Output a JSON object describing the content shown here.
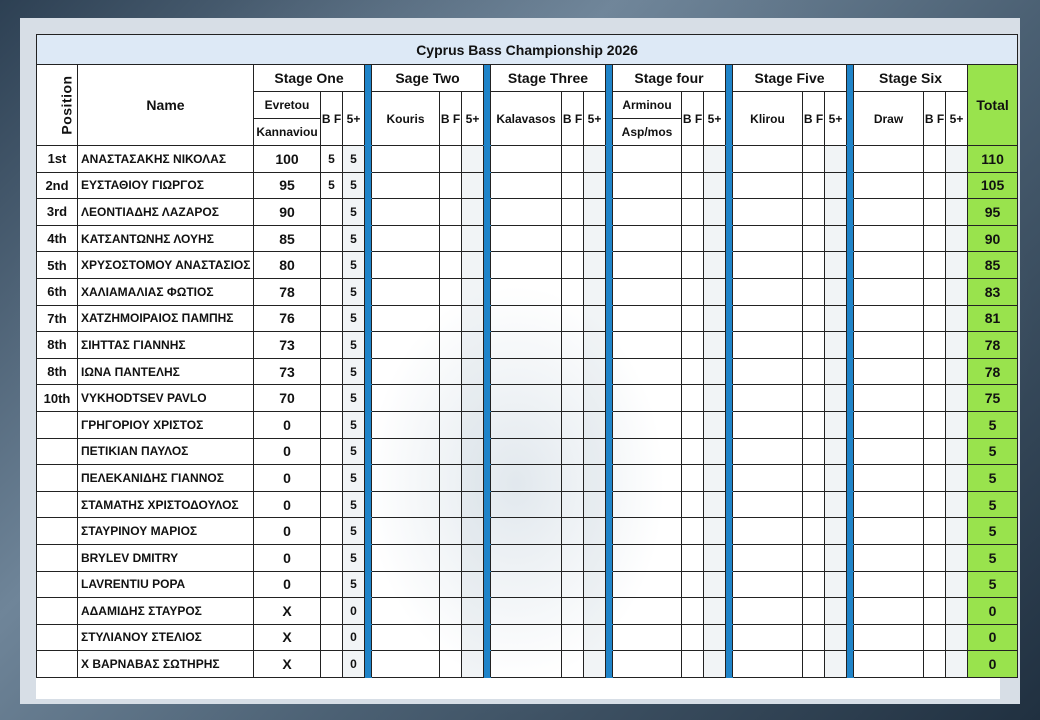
{
  "title": "Cyprus Bass Championship 2026",
  "header": {
    "position": "Position",
    "name": "Name",
    "total": "Total",
    "bf": "B F",
    "five_plus": "5+"
  },
  "stages": [
    {
      "name": "Stage One",
      "venue_top": "Evretou",
      "venue_bottom": "Kannaviou"
    },
    {
      "name": "Sage Two",
      "venue": "Kouris"
    },
    {
      "name": "Stage Three",
      "venue": "Kalavasos"
    },
    {
      "name": "Stage four",
      "venue_top": "Arminou",
      "venue_bottom": "Asp/mos"
    },
    {
      "name": "Stage Five",
      "venue": "Klirou"
    },
    {
      "name": "Stage Six",
      "venue": "Draw"
    }
  ],
  "rows": [
    {
      "pos": "1st",
      "name": "ΑΝΑΣΤΑΣΑΚΗΣ ΝΙΚΟΛΑΣ",
      "s1": "100",
      "bf": "5",
      "five": "5",
      "total": "110"
    },
    {
      "pos": "2nd",
      "name": "ΕΥΣΤΑΘΙΟΥ ΓΙΩΡΓΟΣ",
      "s1": "95",
      "bf": "5",
      "five": "5",
      "total": "105"
    },
    {
      "pos": "3rd",
      "name": "ΛΕΟΝΤΙΑΔΗΣ ΛΑΖΑΡΟΣ",
      "s1": "90",
      "bf": "",
      "five": "5",
      "total": "95"
    },
    {
      "pos": "4th",
      "name": "ΚΑΤΣΑΝΤΩΝΗΣ ΛΟΥΗΣ",
      "s1": "85",
      "bf": "",
      "five": "5",
      "total": "90"
    },
    {
      "pos": "5th",
      "name": "ΧΡΥΣΟΣΤΟΜΟΥ ΑΝΑΣΤΑΣΙΟΣ",
      "s1": "80",
      "bf": "",
      "five": "5",
      "total": "85"
    },
    {
      "pos": "6th",
      "name": "ΧΑΛΙΑΜΑΛΙΑΣ ΦΩΤΙΟΣ",
      "s1": "78",
      "bf": "",
      "five": "5",
      "total": "83"
    },
    {
      "pos": "7th",
      "name": "ΧΑΤΖΗΜΟΙΡΑΙΟΣ ΠΑΜΠΗΣ",
      "s1": "76",
      "bf": "",
      "five": "5",
      "total": "81"
    },
    {
      "pos": "8th",
      "name": "ΣΙΗΤΤΑΣ ΓΙΑΝΝΗΣ",
      "s1": "73",
      "bf": "",
      "five": "5",
      "total": "78"
    },
    {
      "pos": "8th",
      "name": "ΙΩΝΑ ΠΑΝΤΕΛΗΣ",
      "s1": "73",
      "bf": "",
      "five": "5",
      "total": "78"
    },
    {
      "pos": "10th",
      "name": "VYKHODTSEV PAVLO",
      "s1": "70",
      "bf": "",
      "five": "5",
      "total": "75"
    },
    {
      "pos": "",
      "name": "ΓΡΗΓΟΡΙΟΥ ΧΡΙΣΤΟΣ",
      "s1": "0",
      "bf": "",
      "five": "5",
      "total": "5"
    },
    {
      "pos": "",
      "name": "ΠΕΤΙΚΙΑΝ ΠΑΥΛΟΣ",
      "s1": "0",
      "bf": "",
      "five": "5",
      "total": "5"
    },
    {
      "pos": "",
      "name": "ΠΕΛΕΚΑΝΙΔΗΣ ΓΙΑΝΝΟΣ",
      "s1": "0",
      "bf": "",
      "five": "5",
      "total": "5"
    },
    {
      "pos": "",
      "name": "ΣΤΑΜΑΤΗΣ ΧΡΙΣΤΟΔΟΥΛΟΣ",
      "s1": "0",
      "bf": "",
      "five": "5",
      "total": "5"
    },
    {
      "pos": "",
      "name": "ΣΤΑΥΡΙΝΟΥ ΜΑΡΙΟΣ",
      "s1": "0",
      "bf": "",
      "five": "5",
      "total": "5"
    },
    {
      "pos": "",
      "name": "BRYLEV DMITRY",
      "s1": "0",
      "bf": "",
      "five": "5",
      "total": "5"
    },
    {
      "pos": "",
      "name": "LAVRENTIU POPA",
      "s1": "0",
      "bf": "",
      "five": "5",
      "total": "5"
    },
    {
      "pos": "",
      "name": "ΑΔΑΜΙΔΗΣ ΣΤΑΥΡΟΣ",
      "s1": "X",
      "bf": "",
      "five": "0",
      "total": "0"
    },
    {
      "pos": "",
      "name": "ΣΤΥΛΙΑΝΟΥ ΣΤΕΛΙΟΣ",
      "s1": "X",
      "bf": "",
      "five": "0",
      "total": "0"
    },
    {
      "pos": "",
      "name": "Χ ΒΑΡΝΑΒΑΣ ΣΩΤΗΡΗΣ",
      "s1": "X",
      "bf": "",
      "five": "0",
      "total": "0"
    }
  ]
}
